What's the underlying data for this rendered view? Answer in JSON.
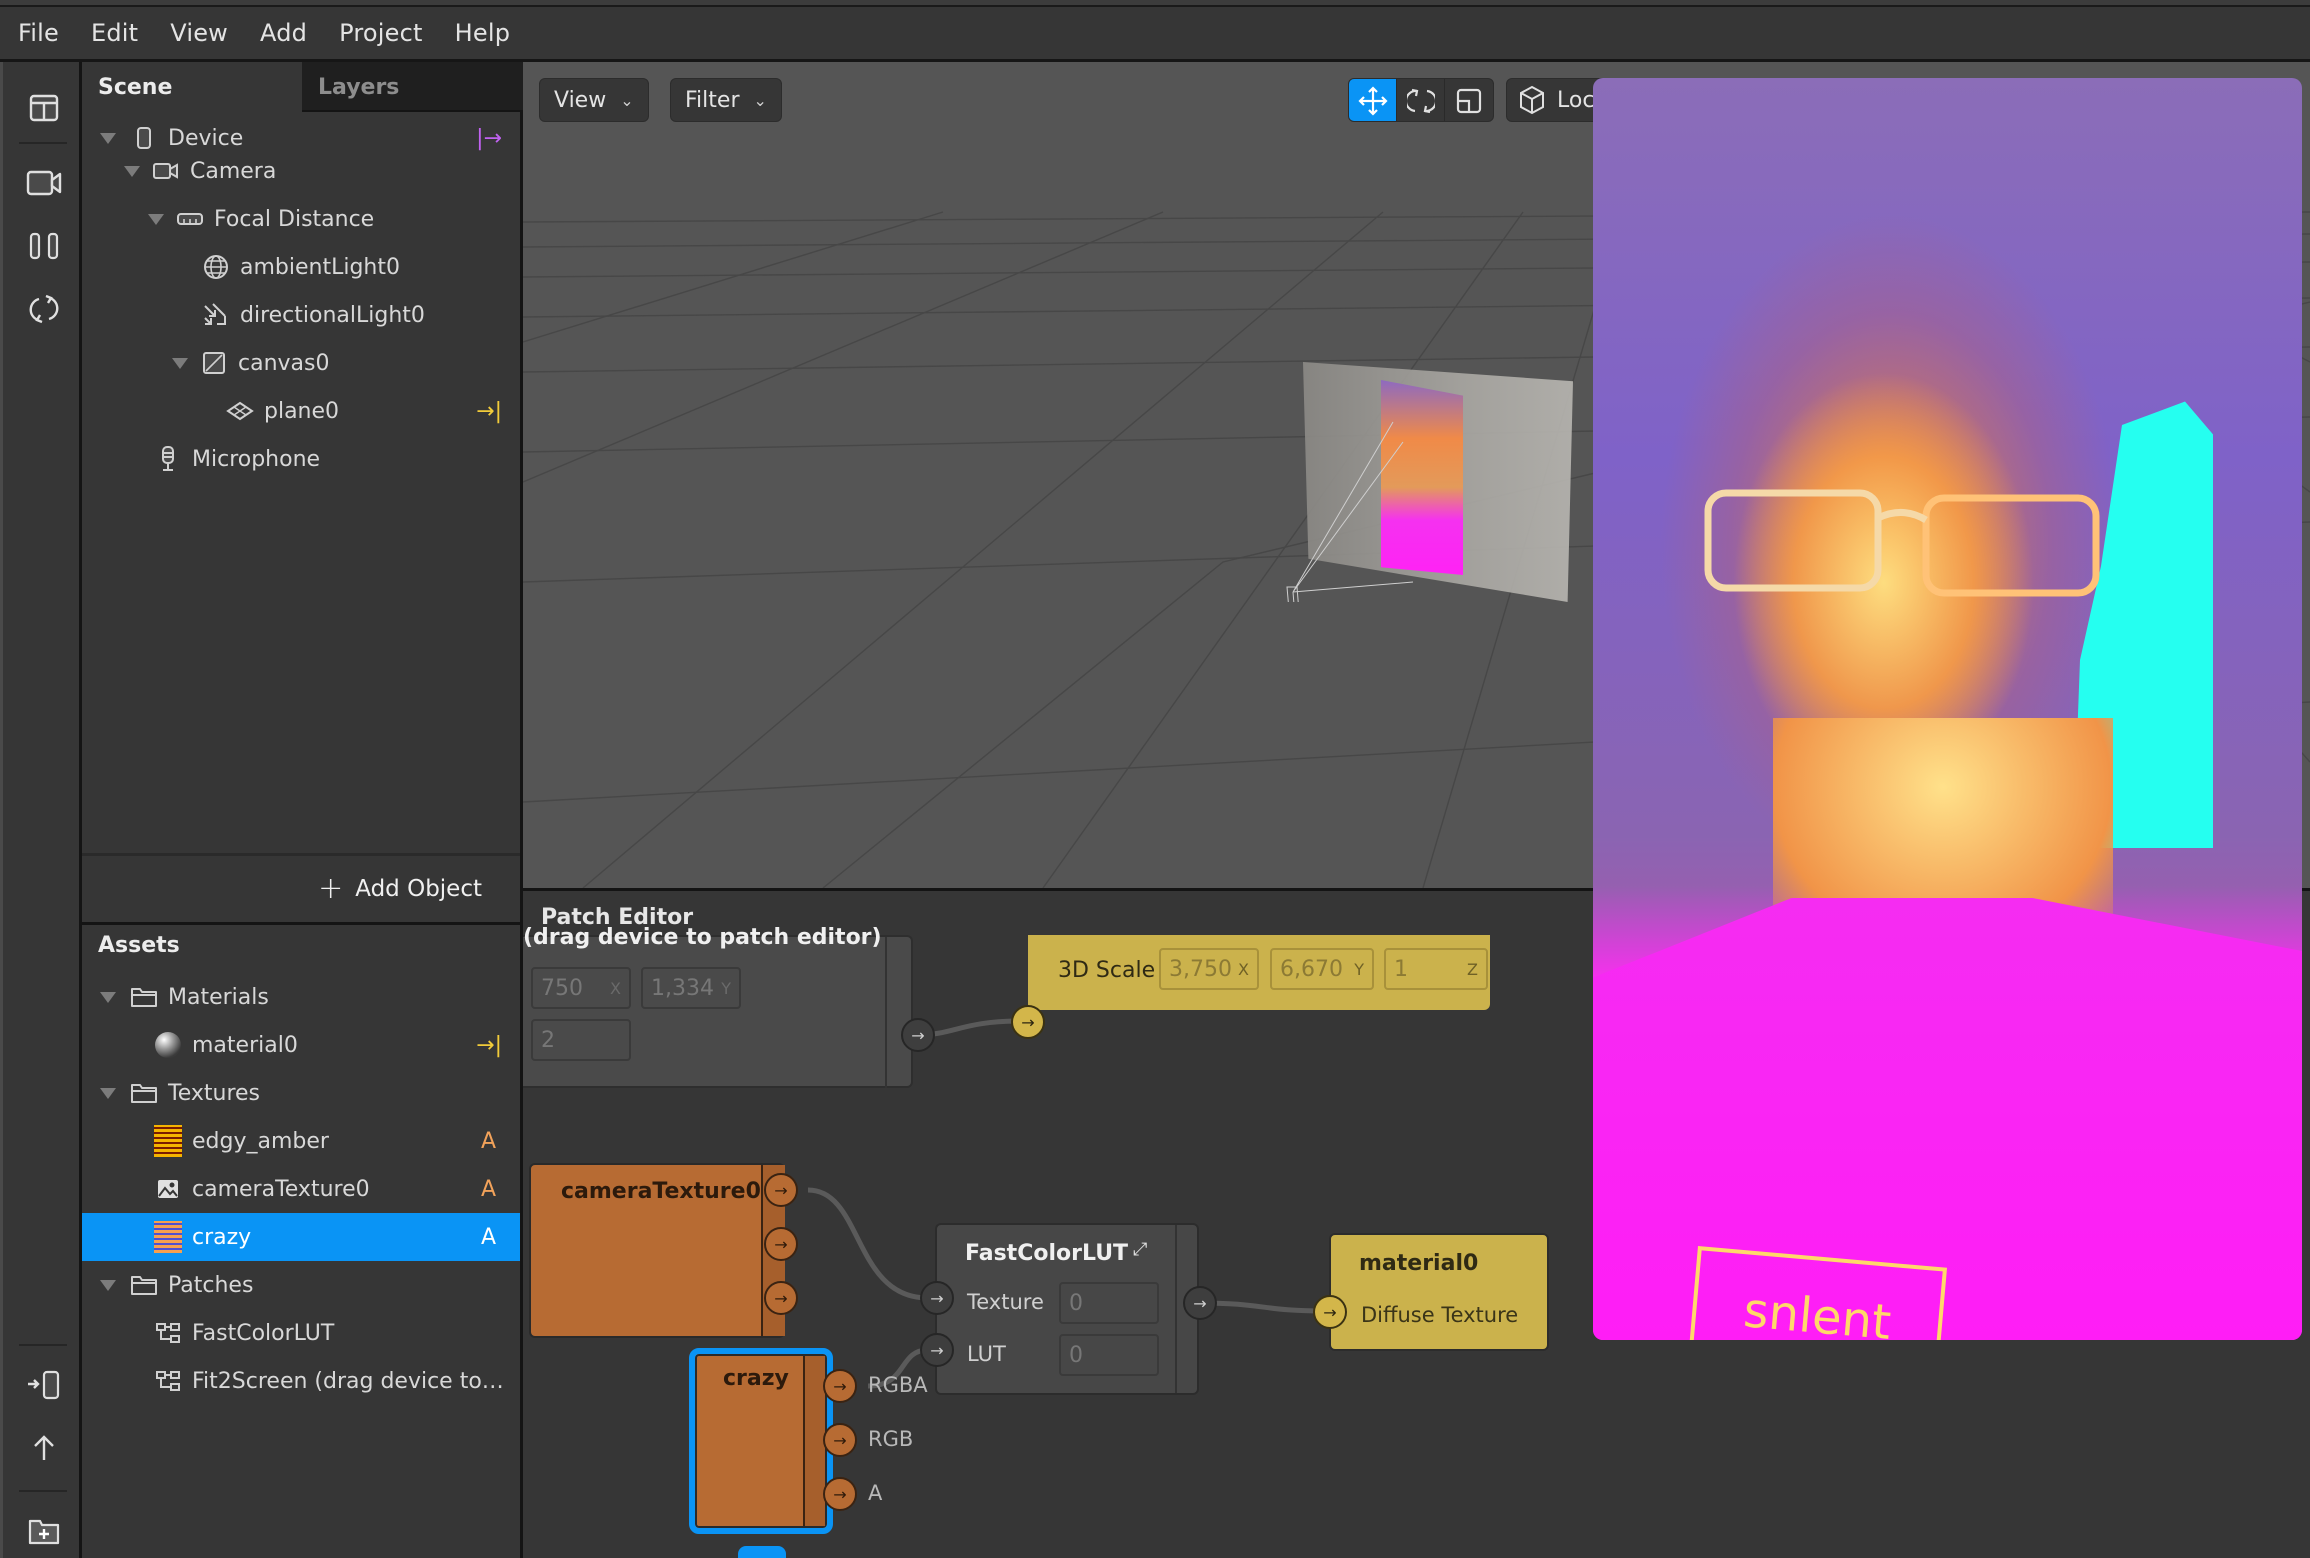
{
  "menu": [
    "File",
    "Edit",
    "View",
    "Add",
    "Project",
    "Help"
  ],
  "scene_panel": {
    "tabs": [
      {
        "label": "Scene",
        "active": true
      },
      {
        "label": "Layers",
        "active": false
      }
    ],
    "tree": [
      {
        "label": "Device",
        "icon": "device-icon",
        "depth": 0,
        "expanded": true,
        "action": "|→"
      },
      {
        "label": "Camera",
        "icon": "camera-icon",
        "depth": 1,
        "expanded": true
      },
      {
        "label": "Focal Distance",
        "icon": "ruler-icon",
        "depth": 2,
        "expanded": true
      },
      {
        "label": "ambientLight0",
        "icon": "globe-icon",
        "depth": 3
      },
      {
        "label": "directionalLight0",
        "icon": "directional-light-icon",
        "depth": 3
      },
      {
        "label": "canvas0",
        "icon": "canvas-icon",
        "depth": 3,
        "expanded": true
      },
      {
        "label": "plane0",
        "icon": "plane-icon",
        "depth": 4,
        "action": "→|"
      },
      {
        "label": "Microphone",
        "icon": "microphone-icon",
        "depth": 1
      }
    ],
    "add_object_label": "Add Object"
  },
  "assets": {
    "title": "Assets",
    "rows": [
      {
        "label": "Materials",
        "type": "folder"
      },
      {
        "label": "material0",
        "type": "material",
        "action": "→|"
      },
      {
        "label": "Textures",
        "type": "folder"
      },
      {
        "label": "edgy_amber",
        "type": "texture-lut",
        "badge": "A"
      },
      {
        "label": "cameraTexture0",
        "type": "image",
        "badge": "A"
      },
      {
        "label": "crazy",
        "type": "texture-lut",
        "badge": "A",
        "selected": true
      },
      {
        "label": "Patches",
        "type": "folder"
      },
      {
        "label": "FastColorLUT",
        "type": "patch"
      },
      {
        "label": "Fit2Screen (drag device to…",
        "type": "patch"
      }
    ]
  },
  "viewport": {
    "view_label": "View",
    "filter_label": "Filter",
    "local_label": "Local",
    "active_gizmo": "move"
  },
  "patch_editor": {
    "title": "Patch Editor",
    "fit2screen": {
      "title_fragment": "(drag device to patch editor)",
      "x": "750",
      "y": "1,334",
      "scale": "2",
      "x_axis": "X",
      "y_axis": "Y"
    },
    "scale_node": {
      "label": "3D Scale",
      "x": "3,750",
      "y": "6,670",
      "z": "1",
      "x_axis": "X",
      "y_axis": "Y",
      "z_axis": "Z"
    },
    "camera_texture_node": {
      "label": "cameraTexture0"
    },
    "crazy_node": {
      "label": "crazy",
      "outputs": [
        "RGBA",
        "RGB",
        "A"
      ]
    },
    "fastcolorlut_node": {
      "label": "FastColorLUT",
      "inputs": [
        {
          "label": "Texture",
          "value": "0"
        },
        {
          "label": "LUT",
          "value": "0"
        }
      ]
    },
    "material_node": {
      "label": "material0",
      "input": "Diffuse Texture"
    }
  },
  "preview": {
    "shirt_text": "snlent"
  },
  "colors": {
    "accent": "#0a94f5",
    "texture_node": "#b76b33",
    "material_node": "#d3b64a",
    "badge": "#f2a25a",
    "device_action": "#c062f0",
    "plane_action": "#f2cc3a"
  }
}
